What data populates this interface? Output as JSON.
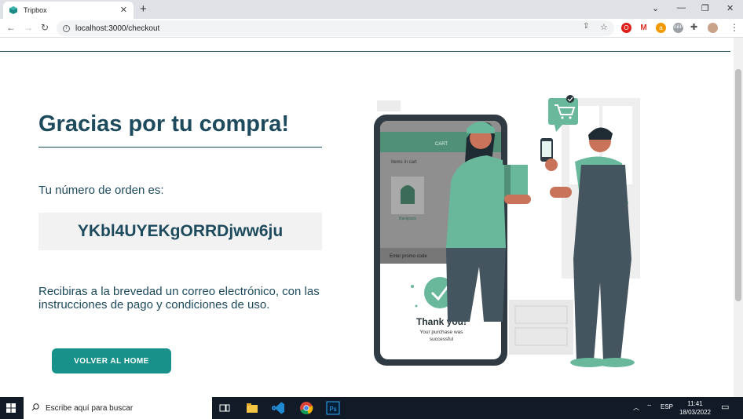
{
  "browser": {
    "tab_title": "Tripbox",
    "url": "localhost:3000/checkout"
  },
  "page": {
    "title": "Gracias por tu compra!",
    "order_label": "Tu número de orden es:",
    "order_number": "YKbl4UYEKgORRDjww6ju",
    "message": "Recibiras a la brevedad un correo electrónico, con las instrucciones de pago y condiciones de uso.",
    "home_button": "VOLVER AL HOME"
  },
  "illustration": {
    "cart_header": "CART",
    "items_label": "Items in cart",
    "item_name": "Backpack",
    "promo_placeholder": "Enter promo code",
    "thanks_title": "Thank you!",
    "thanks_line1": "Your purchase was",
    "thanks_line2": "successful"
  },
  "taskbar": {
    "search_placeholder": "Escribe aquí para buscar",
    "lang": "ESP",
    "time": "11:41",
    "date": "18/03/2022"
  },
  "colors": {
    "brand": "#1d4a5c",
    "accent": "#17918a",
    "illustration_green": "#6ab89c"
  }
}
